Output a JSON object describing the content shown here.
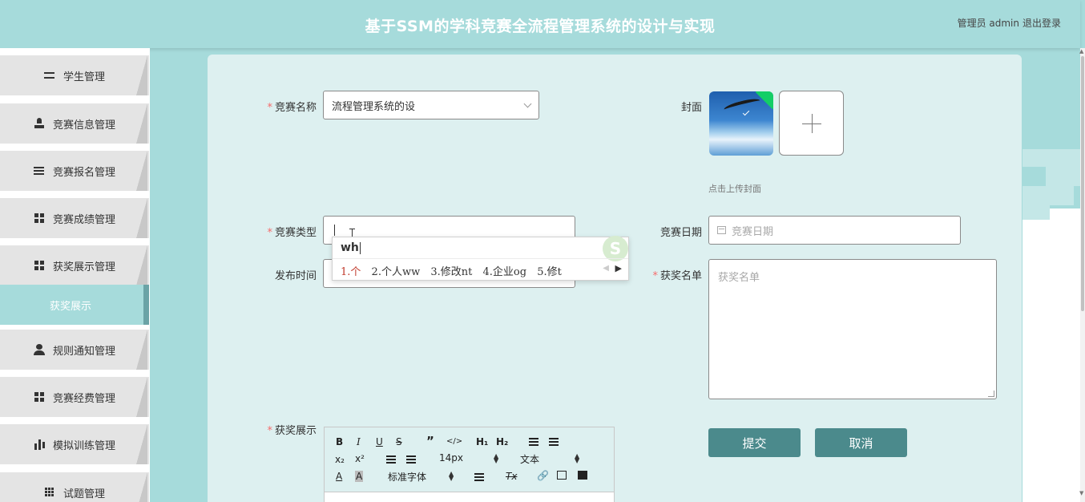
{
  "header": {
    "title": "基于SSM的学科竞赛全流程管理系统的设计与实现",
    "user": "管理员 admin",
    "logout": "退出登录"
  },
  "sidebar": {
    "items": [
      {
        "label": "学生管理",
        "icon": "sliders-icon"
      },
      {
        "label": "竞赛信息管理",
        "icon": "person-icon"
      },
      {
        "label": "竞赛报名管理",
        "icon": "list-icon"
      },
      {
        "label": "竞赛成绩管理",
        "icon": "grid-icon"
      },
      {
        "label": "获奖展示管理",
        "icon": "grid-icon"
      },
      {
        "label": "规则通知管理",
        "icon": "user-icon"
      },
      {
        "label": "竞赛经费管理",
        "icon": "grid-icon"
      },
      {
        "label": "模拟训练管理",
        "icon": "bar-chart-icon"
      },
      {
        "label": "试题管理",
        "icon": "dots-grid-icon"
      }
    ],
    "active_sub": "获奖展示"
  },
  "form": {
    "name_label": "竞赛名称",
    "name_value": "流程管理系统的设",
    "cover_label": "封面",
    "cover_tip": "点击上传封面",
    "type_label": "竞赛类型",
    "date_label": "竞赛日期",
    "date_placeholder": "竞赛日期",
    "publish_label": "发布时间",
    "winners_label": "获奖名单",
    "winners_placeholder": "获奖名单",
    "showcase_label": "获奖展示",
    "submit": "提交",
    "cancel": "取消"
  },
  "editor": {
    "bold": "B",
    "italic": "I",
    "underline": "U",
    "strike": "S",
    "quote": "”",
    "code": "</>",
    "h1": "H₁",
    "h2": "H₂",
    "sub": "x₂",
    "sup": "x²",
    "size": "14px",
    "format": "文本",
    "font": "标准字体",
    "color_a": "A",
    "bg_a": "A",
    "clean": "Tx"
  },
  "ime": {
    "input": "wh",
    "candidates": [
      "1.个",
      "2.个人ww",
      "3.修改nt",
      "4.企业og",
      "5.修t"
    ],
    "logo": "S"
  }
}
